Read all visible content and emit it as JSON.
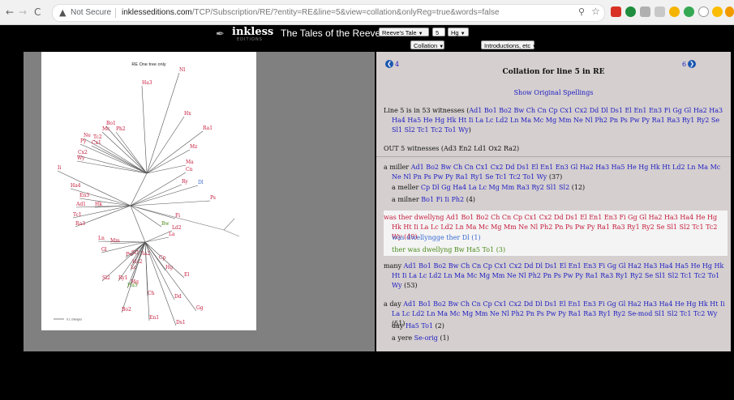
{
  "browser": {
    "back": "←",
    "forward": "→",
    "reload": "C",
    "security_label": "Not Secure",
    "url_host": "inklesseditions.com",
    "url_path": "/TCP/Subscription/RE/?entity=RE&line=5&view=collation&onlyReg=true&words=false"
  },
  "header": {
    "logo": "inkless",
    "logo_sub": "EDITIONS",
    "title": "The Tales of the Reeve and Cook",
    "select_tale": "Reeve's Tale",
    "line_input": "5",
    "select_witness": "Hg",
    "select_view": "Collation",
    "select_intro": "Introductions, etc"
  },
  "tree": {
    "title": "RE One tree only",
    "scale_label": "0.1 changes",
    "leaves": [
      {
        "t": "Nl",
        "c": "#c41a3a"
      },
      {
        "t": "Ha3",
        "c": "#c41a3a"
      },
      {
        "t": "Hx",
        "c": "#c41a3a"
      },
      {
        "t": "Ra1",
        "c": "#c41a3a"
      },
      {
        "t": "Bo1",
        "c": "#c41a3a"
      },
      {
        "t": "Mc",
        "c": "#c41a3a"
      },
      {
        "t": "Ph2",
        "c": "#c41a3a"
      },
      {
        "t": "Mz",
        "c": "#c41a3a"
      },
      {
        "t": "Ne",
        "c": "#c41a3a"
      },
      {
        "t": "Tc2",
        "c": "#c41a3a"
      },
      {
        "t": "Cx1",
        "c": "#c41a3a"
      },
      {
        "t": "Py",
        "c": "#c41a3a"
      },
      {
        "t": "Cx2",
        "c": "#c41a3a"
      },
      {
        "t": "Wy",
        "c": "#c41a3a"
      },
      {
        "t": "Ma",
        "c": "#c41a3a"
      },
      {
        "t": "Cn",
        "c": "#c41a3a"
      },
      {
        "t": "Ii",
        "c": "#c41a3a"
      },
      {
        "t": "Ry",
        "c": "#c41a3a"
      },
      {
        "t": "Dl",
        "c": "#3a6ad0"
      },
      {
        "t": "Ha4",
        "c": "#c41a3a"
      },
      {
        "t": "En3",
        "c": "#c41a3a"
      },
      {
        "t": "Ps",
        "c": "#c41a3a"
      },
      {
        "t": "Ad1",
        "c": "#c41a3a"
      },
      {
        "t": "Hk",
        "c": "#c41a3a"
      },
      {
        "t": "Tc1",
        "c": "#c41a3a"
      },
      {
        "t": "Fi",
        "c": "#c41a3a"
      },
      {
        "t": "Ra3",
        "c": "#c41a3a"
      },
      {
        "t": "Bw",
        "c": "#4a8a1a"
      },
      {
        "t": "Ld2",
        "c": "#c41a3a"
      },
      {
        "t": "La",
        "c": "#c41a3a"
      },
      {
        "t": "Ln",
        "c": "#c41a3a"
      },
      {
        "t": "Mm",
        "c": "#c41a3a"
      },
      {
        "t": "Gl",
        "c": "#c41a3a"
      },
      {
        "t": "Pw",
        "c": "#c41a3a"
      },
      {
        "t": "Sl1",
        "c": "#c41a3a"
      },
      {
        "t": "Ra2",
        "c": "#c41a3a"
      },
      {
        "t": "Cp",
        "c": "#c41a3a"
      },
      {
        "t": "Ha2",
        "c": "#c41a3a"
      },
      {
        "t": "Lc",
        "c": "#c41a3a"
      },
      {
        "t": "Hg",
        "c": "#c41a3a"
      },
      {
        "t": "Sl2",
        "c": "#c41a3a"
      },
      {
        "t": "Ry1",
        "c": "#c41a3a"
      },
      {
        "t": "Mg",
        "c": "#c41a3a"
      },
      {
        "t": "El",
        "c": "#c41a3a"
      },
      {
        "t": "Ha5",
        "c": "#4a8a1a"
      },
      {
        "t": "Ch",
        "c": "#c41a3a"
      },
      {
        "t": "Dd",
        "c": "#c41a3a"
      },
      {
        "t": "Gg",
        "c": "#c41a3a"
      },
      {
        "t": "Bo2",
        "c": "#c41a3a"
      },
      {
        "t": "En1",
        "c": "#c41a3a"
      },
      {
        "t": "Ds1",
        "c": "#c41a3a"
      }
    ]
  },
  "collation": {
    "prev_label": "4",
    "next_label": "6",
    "heading": "Collation for line 5 in RE",
    "show_original": "Show Original Spellings",
    "summary_prefix": "Line 5 is in 53 witnesses (",
    "summary_sigla": "Ad1 Bo1 Bo2 Bw Ch Cn Cp Cx1 Cx2 Dd Dl Ds1 El En1 En3 Fi Gg Gl Ha2 Ha3 Ha4 Ha5 He Hg Hk Ht Ii La Lc Ld2 Ln Ma Mc Mg Mm Ne Nl Ph2 Pn Ps Pw Py Ra1 Ra3 Ry1 Ry2 Se Sl1 Sl2 Tc1 Tc2 To1 Wy",
    "summary_suffix": ")",
    "out_text": "OUT 5 witnesses (Ad3 En2 Ld1 Ox2 Ra2)",
    "groups": [
      {
        "lemma": "a miller",
        "sigla": "Ad1 Bo2 Bw Ch Cn Cx1 Cx2 Dd Ds1 El En1 En3 Gl Ha2 Ha3 Ha5 He Hg Hk Ht Ld2 Ln Ma Mc Ne Nl Pn Ps Pw Py Ra1 Ry1 Se Tc1 Tc2 To1 Wy",
        "count": "(37)",
        "variants": [
          {
            "lemma": "a meller",
            "sigla": "Cp Dl Gg Ha4 La Lc Mg Mm Ra3 Ry2 Sl1 Sl2",
            "count": "(12)"
          },
          {
            "lemma": "a milner",
            "sigla": "Bo1 Fi Ii Ph2",
            "count": "(4)"
          }
        ]
      },
      {
        "lemma": "was ther dwellyng",
        "sigla": "Ad1 Bo1 Bo2 Ch Cn Cp Cx1 Cx2 Dd Ds1 El En1 En3 Fi Gg Gl Ha2 Ha3 Ha4 He Hg Hk Ht Ii La Lc Ld2 Ln Ma Mc Mg Mm Ne Nl Ph2 Pn Ps Pw Py Ra1 Ra3 Ry1 Ry2 Se Sl1 Sl2 Tc1 Tc2 Wy",
        "count": "(49)",
        "variants": [
          {
            "lemma": "was dwellyngge ther",
            "sigla": "Dl",
            "count": "(1)"
          },
          {
            "lemma": "ther was dwellyng",
            "sigla": "Bw Ha5 To1",
            "count": "(3)"
          }
        ]
      },
      {
        "lemma": "many",
        "sigla": "Ad1 Bo1 Bo2 Bw Ch Cn Cp Cx1 Cx2 Dd Dl Ds1 El En1 En3 Fi Gg Gl Ha2 Ha3 Ha4 Ha5 He Hg Hk Ht Ii La Lc Ld2 Ln Ma Mc Mg Mm Ne Nl Ph2 Pn Ps Pw Py Ra1 Ra3 Ry1 Ry2 Se Sl1 Sl2 Tc1 Tc2 To1 Wy",
        "count": "(53)",
        "variants": []
      },
      {
        "lemma": "a day",
        "sigla": "Ad1 Bo1 Bo2 Bw Ch Cn Cp Cx1 Cx2 Dd Dl Ds1 El En1 En3 Fi Gg Gl Ha2 Ha3 Ha4 He Hg Hk Ht Ii La Lc Ld2 Ln Ma Mc Mg Mm Ne Nl Ph2 Pn Ps Pw Py Ra1 Ra3 Ry1 Ry2 Se-mod Sl1 Sl2 Tc1 Tc2 Wy",
        "count": "(51)",
        "variants": [
          {
            "lemma": "day",
            "sigla": "Ha5 To1",
            "count": "(2)"
          },
          {
            "lemma": "a yere",
            "sigla": "Se-orig",
            "count": "(1)"
          }
        ]
      }
    ]
  }
}
